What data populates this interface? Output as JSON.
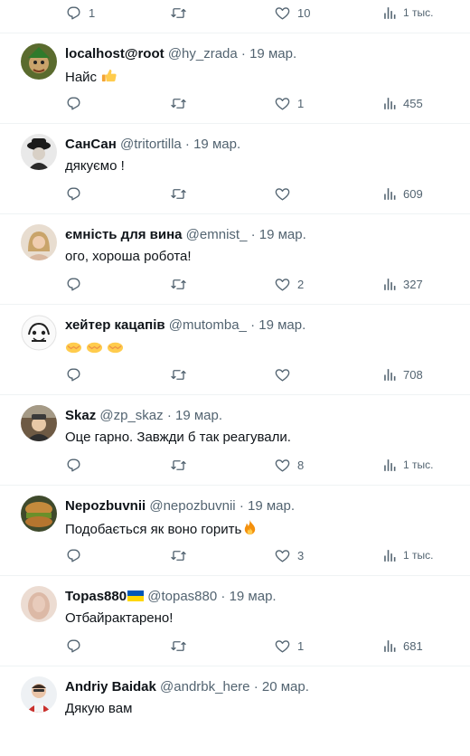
{
  "top_tweet": {
    "replies": "1",
    "likes": "10",
    "views": "1 тыс."
  },
  "tweets": [
    {
      "name": "localhost@root",
      "handle": "@hy_zrada",
      "date": "19 мар.",
      "text": "Найс",
      "emoji": "thumbs-up",
      "replies": "",
      "likes": "1",
      "views": "455"
    },
    {
      "name": "СанСан",
      "handle": "@tritortilla",
      "date": "19 мар.",
      "text": "дякуємо !",
      "replies": "",
      "likes": "",
      "views": "609"
    },
    {
      "name": "ємність для вина",
      "handle": "@emnist_",
      "date": "19 мар.",
      "text": "ого, хороша робота!",
      "replies": "",
      "likes": "2",
      "views": "327"
    },
    {
      "name": "хейтер кацапів",
      "handle": "@mutomba_",
      "date": "19 мар.",
      "text": "",
      "emoji": "handshake-x3",
      "replies": "",
      "likes": "",
      "views": "708"
    },
    {
      "name": "Skaz",
      "handle": "@zp_skaz",
      "date": "19 мар.",
      "text": "Оце гарно. Завжди б так реагували.",
      "replies": "",
      "likes": "8",
      "views": "1 тыс."
    },
    {
      "name": "Nepozbuvnii",
      "handle": "@nepozbuvnii",
      "date": "19 мар.",
      "text": "Подобається як воно горить",
      "emoji": "fire",
      "replies": "",
      "likes": "3",
      "views": "1 тыс."
    },
    {
      "name": "Topas880",
      "handle": "@topas880",
      "date": "19 мар.",
      "text": "Отбайрактарено!",
      "flag": "ukraine-flag",
      "replies": "",
      "likes": "1",
      "views": "681"
    },
    {
      "name": "Andriy Baidak",
      "handle": "@andrbk_here",
      "date": "20 мар.",
      "text": "Дякую вам"
    }
  ],
  "colors": {
    "text": "#0f1419",
    "muted": "#536471",
    "divider": "#eff3f4"
  }
}
